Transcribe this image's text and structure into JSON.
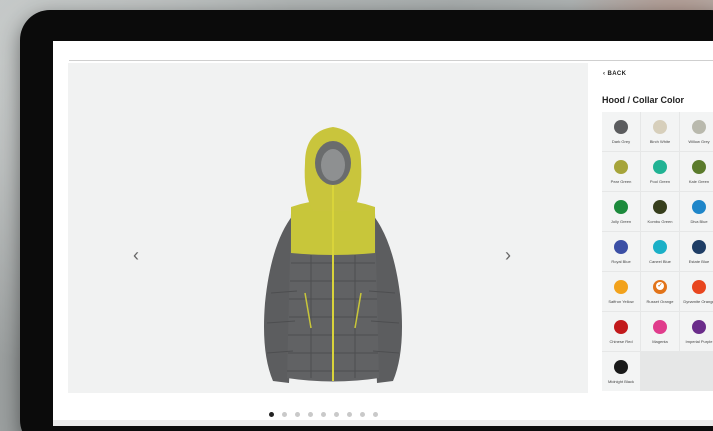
{
  "nav": {
    "back_label": "BACK",
    "prev_icon": "‹",
    "next_icon": "›"
  },
  "panel": {
    "title": "Hood / Collar Color"
  },
  "gallery": {
    "dot_count": 9,
    "active_dot": 0
  },
  "colors": {
    "selected_index": 13,
    "accent": "#e2741a"
  },
  "swatches": [
    {
      "label": "Dark Grey",
      "color": "#5b5c5e"
    },
    {
      "label": "Birch White",
      "color": "#d7cfbb"
    },
    {
      "label": "Willow Grey",
      "color": "#b9b9ad"
    },
    {
      "label": "Pear Green",
      "color": "#a6a43a"
    },
    {
      "label": "Pool Green",
      "color": "#21b394"
    },
    {
      "label": "Kale Green",
      "color": "#5b7b2c"
    },
    {
      "label": "Jolly Green",
      "color": "#1c8a3c"
    },
    {
      "label": "Kombu Green",
      "color": "#373f1d"
    },
    {
      "label": "Diva Blue",
      "color": "#1f86c9"
    },
    {
      "label": "Royal Blue",
      "color": "#3b4fa5"
    },
    {
      "label": "Caneel Blue",
      "color": "#1bb0c7"
    },
    {
      "label": "Estate Blue",
      "color": "#1f3e66"
    },
    {
      "label": "Saffron Yellow",
      "color": "#f2a21c"
    },
    {
      "label": "Russet Orange",
      "color": "#e2741a"
    },
    {
      "label": "Dynamite Orange",
      "color": "#e8461f"
    },
    {
      "label": "Chinese Red",
      "color": "#c21a1c"
    },
    {
      "label": "Magenta",
      "color": "#e03c8c"
    },
    {
      "label": "Imperial Purple",
      "color": "#6a2c8a"
    },
    {
      "label": "Midnight Black",
      "color": "#1a1a1a"
    }
  ]
}
